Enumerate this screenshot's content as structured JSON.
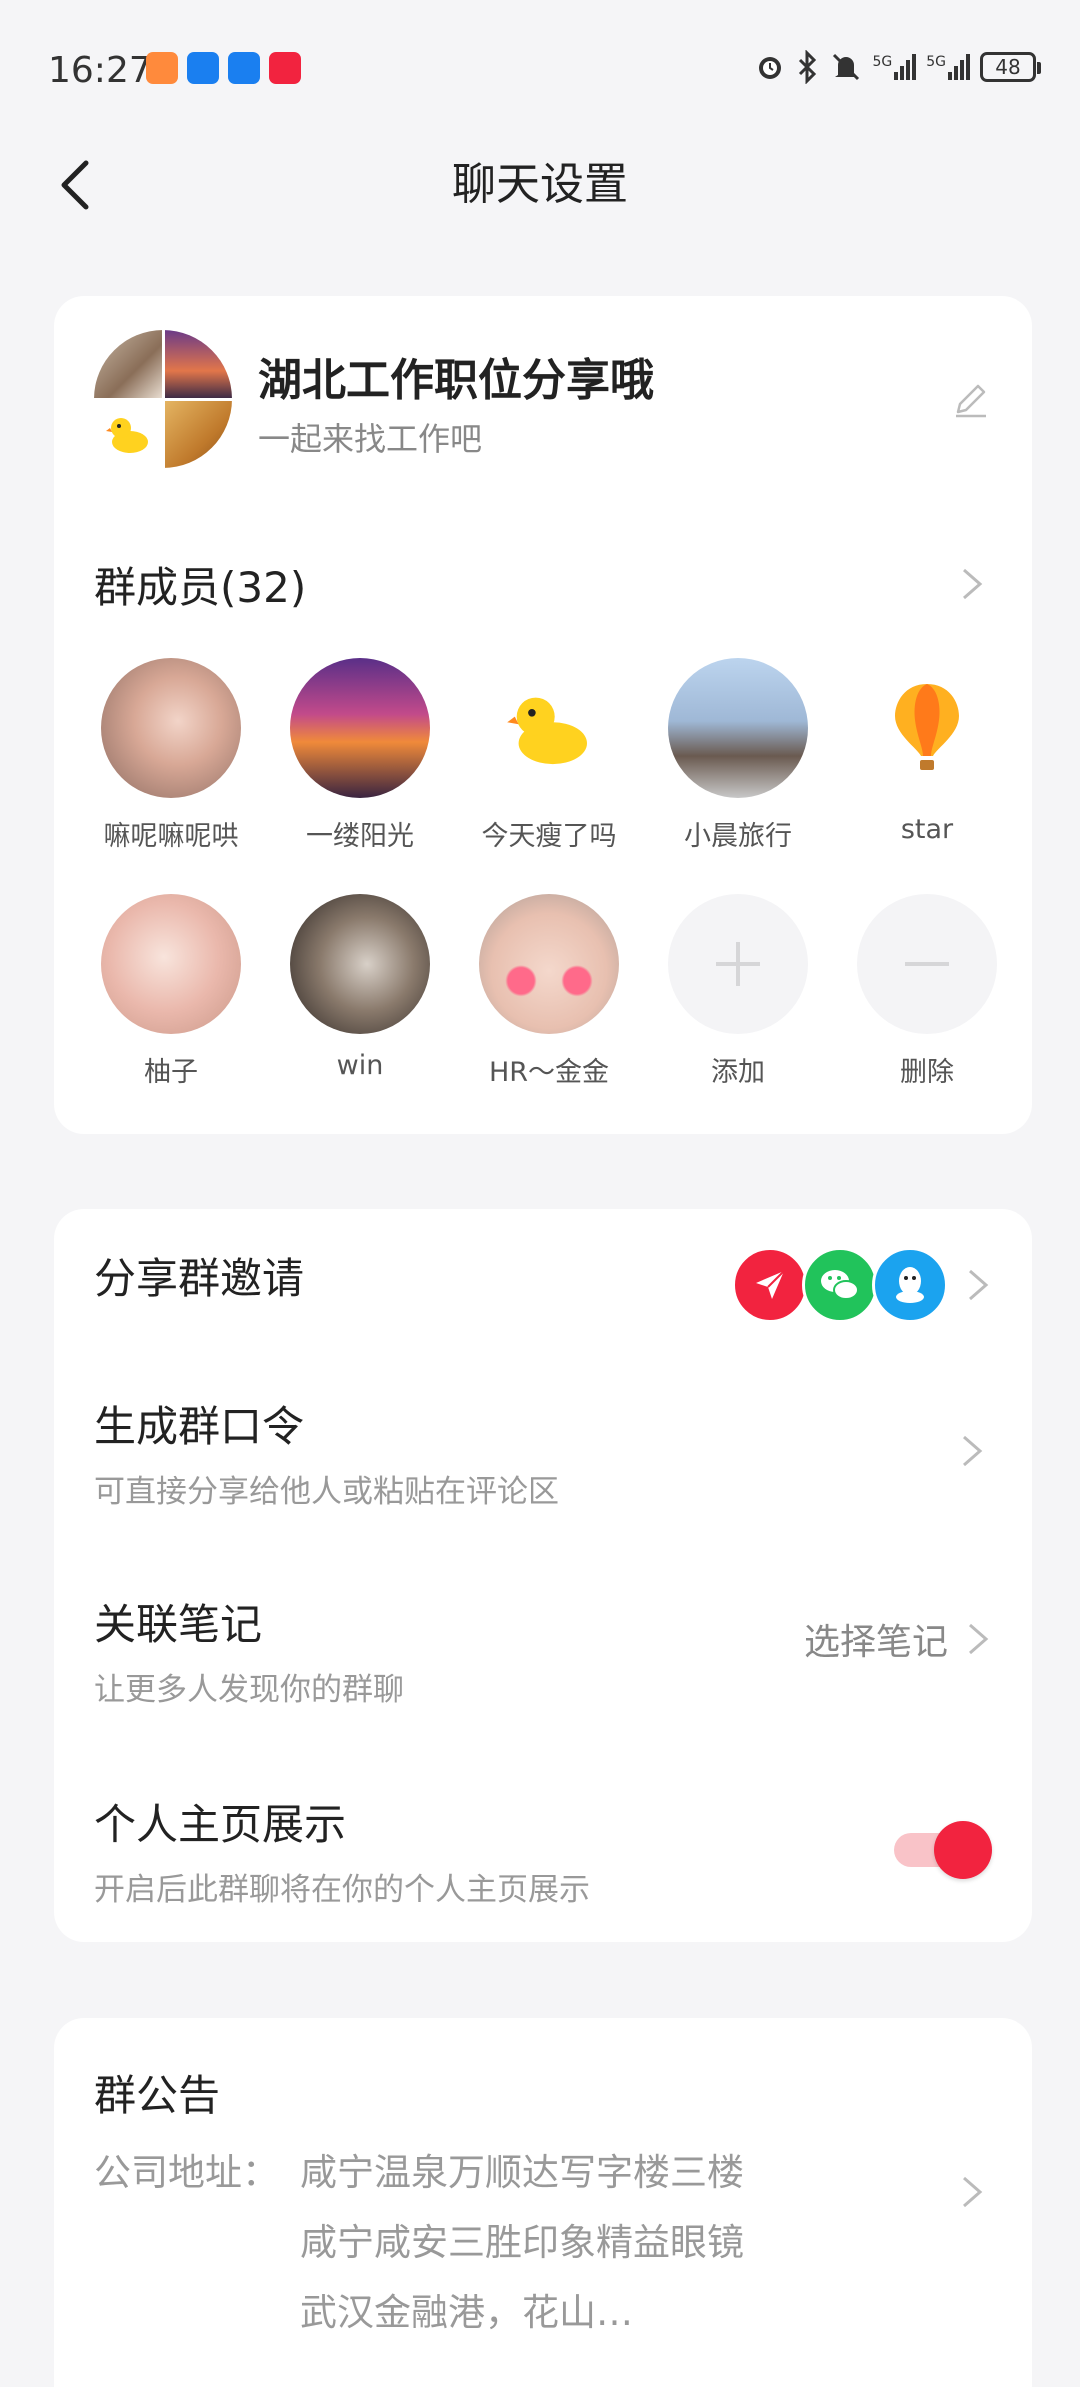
{
  "status_bar": {
    "time": "16:27",
    "battery": "48",
    "signal_label_1": "5G",
    "signal_label_2": "5G"
  },
  "header": {
    "title": "聊天设置"
  },
  "group": {
    "name": "湖北工作职位分享哦",
    "description": "一起来找工作吧"
  },
  "members": {
    "header": "群成员(32)",
    "items": [
      {
        "name": "嘛呢嘛呢哄"
      },
      {
        "name": "一缕阳光"
      },
      {
        "name": "今天瘦了吗"
      },
      {
        "name": "小晨旅行"
      },
      {
        "name": "star"
      },
      {
        "name": "柚子"
      },
      {
        "name": "win"
      },
      {
        "name": "HR～金金"
      }
    ],
    "add_label": "添加",
    "remove_label": "删除"
  },
  "settings": {
    "share_invite": {
      "title": "分享群邀请"
    },
    "group_password": {
      "title": "生成群口令",
      "subtitle": "可直接分享给他人或粘贴在评论区"
    },
    "linked_note": {
      "title": "关联笔记",
      "subtitle": "让更多人发现你的群聊",
      "action": "选择笔记"
    },
    "profile_display": {
      "title": "个人主页展示",
      "subtitle": "开启后此群聊将在你的个人主页展示",
      "enabled": true
    }
  },
  "notice": {
    "title": "群公告",
    "label": "公司地址：",
    "lines": [
      "咸宁温泉万顺达写字楼三楼",
      "咸宁咸安三胜印象精益眼镜",
      "武汉金融港，花山…"
    ]
  },
  "colors": {
    "accent": "#f2233f",
    "share_direct": "#f2233f",
    "share_wechat": "#21c35b",
    "share_qq": "#1ba3ef"
  }
}
